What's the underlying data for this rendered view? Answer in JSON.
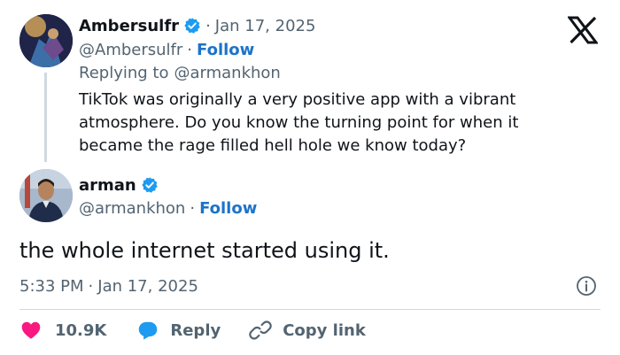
{
  "parent_tweet": {
    "display_name": "Ambersulfr",
    "date": "Jan 17, 2025",
    "handle": "@Ambersulfr",
    "follow_label": "Follow",
    "replying_prefix": "Replying to",
    "replying_to": "@armankhon",
    "text_line1": "TikTok was originally a very positive app with a vibrant",
    "text_line2": "atmosphere. Do you know the turning point for when it",
    "text_line3": "became the rage filled hell hole we know today?"
  },
  "reply_tweet": {
    "display_name": "arman",
    "handle": "@armankhon",
    "follow_label": "Follow",
    "text": "the whole internet started using it.",
    "time": "5:33 PM",
    "date": "Jan 17, 2025"
  },
  "actions": {
    "like_count": "10.9K",
    "reply_label": "Reply",
    "copy_link_label": "Copy link"
  },
  "separator": "·",
  "colors": {
    "follow_link": "#1d73c9",
    "verified_badge": "#1d9bf0",
    "like_heart": "#f91880",
    "reply_bubble": "#1d9bf0",
    "muted_text": "#536471"
  },
  "icons": [
    "x-logo-icon",
    "verified-badge-icon",
    "heart-icon",
    "reply-bubble-icon",
    "link-icon",
    "info-icon"
  ]
}
